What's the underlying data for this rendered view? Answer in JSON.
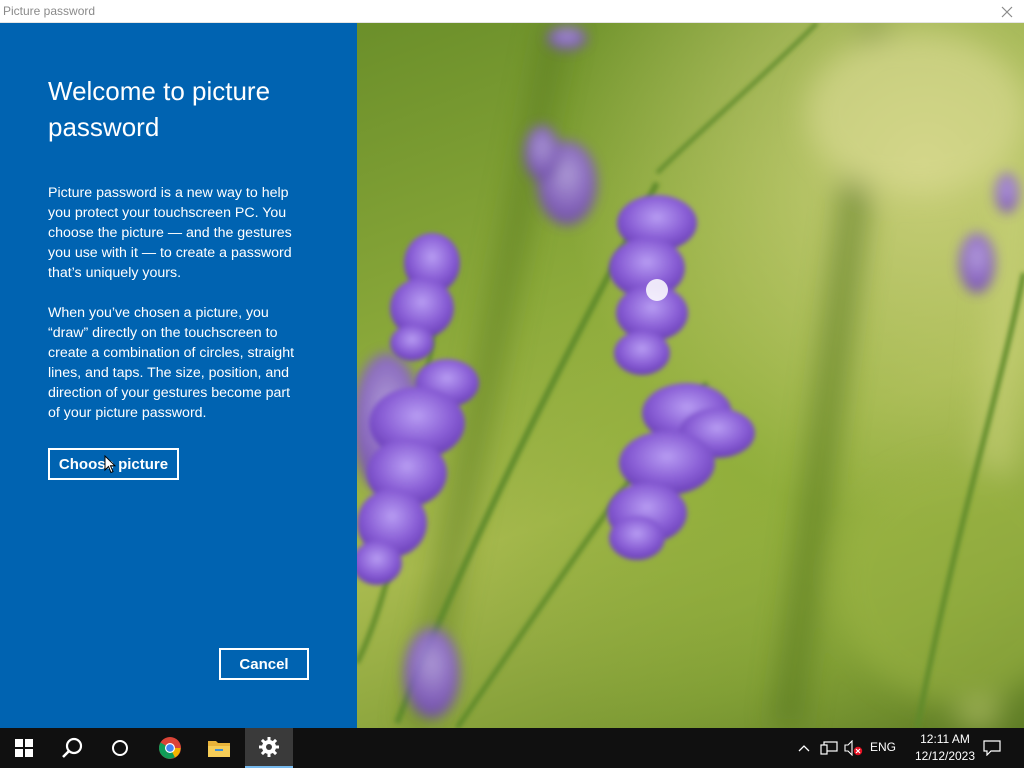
{
  "window": {
    "title": "Picture password"
  },
  "panel": {
    "heading": "Welcome to picture password",
    "paragraph1": "Picture password is a new way to help you protect your touchscreen PC. You choose the picture — and the gestures you use with it — to create a password that’s uniquely yours.",
    "paragraph2": "When you’ve chosen a picture, you “draw” directly on the touchscreen to create a combination of circles, straight lines, and taps. The size, position, and direction of your gestures become part of your picture password.",
    "choose_button": "Choose picture",
    "cancel_button": "Cancel",
    "accent_color": "#0063b1"
  },
  "taskbar": {
    "items": [
      "start-icon",
      "search-icon",
      "cortana-icon",
      "chrome-icon",
      "file-explorer-icon",
      "settings-icon"
    ],
    "active_item": "settings-icon",
    "language": "ENG",
    "time": "12:11 AM",
    "date": "12/12/2023"
  }
}
